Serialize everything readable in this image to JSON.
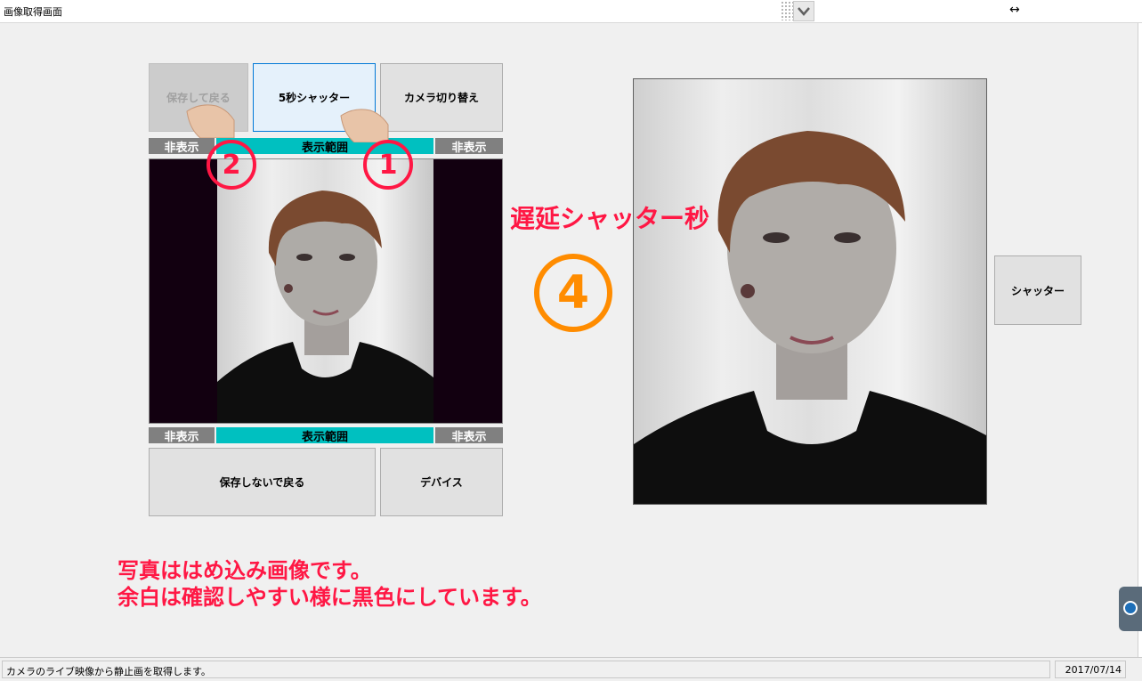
{
  "window": {
    "title": "画像取得画面"
  },
  "buttons": {
    "save_back": "保存して戻る",
    "five_sec_shutter": "5秒シャッター",
    "camera_switch": "カメラ切り替え",
    "no_save_back": "保存しないで戻る",
    "device": "デバイス",
    "shutter": "シャッター"
  },
  "range_bar_top": {
    "left": "非表示",
    "center": "表示範囲",
    "right": "非表示"
  },
  "range_bar_bottom": {
    "left": "非表示",
    "center": "表示範囲",
    "right": "非表示"
  },
  "annotations": {
    "circle_1": "①",
    "circle_2": "②",
    "circle_4": "④",
    "delay_label": "遅延シャッター秒",
    "note_line1": "写真ははめ込み画像です。",
    "note_line2": "余白は確認しやすい様に黒色にしています。"
  },
  "status": {
    "message": "カメラのライブ映像から静止画を取得します。",
    "date": "2017/07/14"
  },
  "colors": {
    "accent": "#0078d7",
    "teal": "#00c0c0",
    "annotation_red": "#ff1744",
    "annotation_orange": "#ff8c00",
    "letterbox": "#120010"
  },
  "icons": [
    "chevron-down-icon",
    "resize-icon",
    "hand-pointer-icon",
    "side-tab-icon"
  ]
}
